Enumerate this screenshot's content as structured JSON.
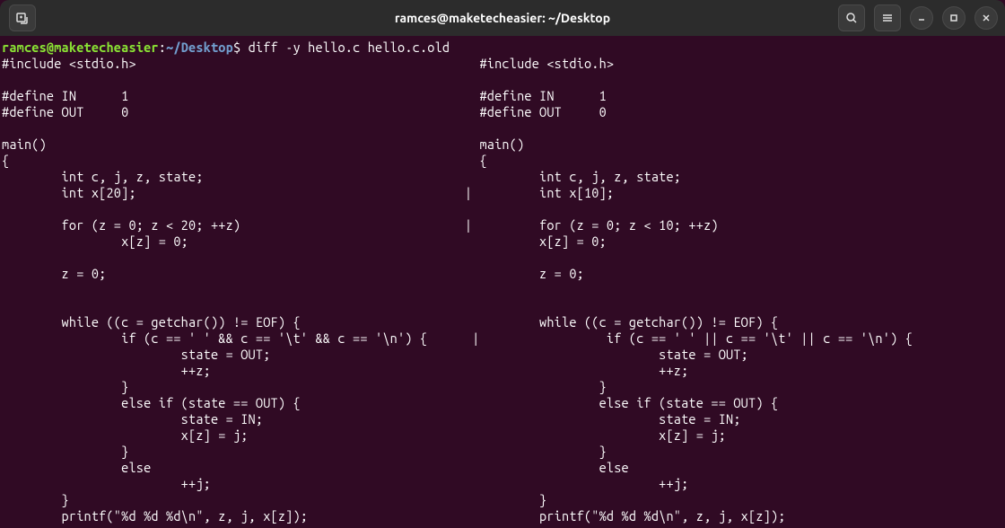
{
  "titlebar": {
    "title": "ramces@maketecheasier: ~/Desktop"
  },
  "prompt": {
    "user": "ramces@maketecheasier",
    "colon": ":",
    "path": "~/Desktop",
    "dollar": "$",
    "command": " diff -y hello.c hello.c.old"
  },
  "diff": {
    "lines": {
      "l0": "#include <stdio.h>                                              #include <stdio.h>",
      "l1": "",
      "l2": "#define IN      1                                               #define IN      1",
      "l3": "#define OUT     0                                               #define OUT     0",
      "l4": "",
      "l5": "main()                                                          main()",
      "l6": "{                                                               {",
      "l7": "        int c, j, z, state;                                             int c, j, z, state;",
      "l8": "        int x[20];                                            |         int x[10];",
      "l9": "",
      "l10": "        for (z = 0; z < 20; ++z)                              |         for (z = 0; z < 10; ++z)",
      "l11": "                x[z] = 0;                                               x[z] = 0;",
      "l12": "",
      "l13": "        z = 0;                                                          z = 0;",
      "l14": "",
      "l15": "",
      "l16": "        while ((c = getchar()) != EOF) {                                while ((c = getchar()) != EOF) {",
      "l17": "                if (c == ' ' && c == '\\t' && c == '\\n') {      |                 if (c == ' ' || c == '\\t' || c == '\\n') {",
      "l18": "                        state = OUT;                                                    state = OUT;",
      "l19": "                        ++z;                                                            ++z;",
      "l20": "                }                                                               }",
      "l21": "                else if (state == OUT) {                                        else if (state == OUT) {",
      "l22": "                        state = IN;                                                     state = IN;",
      "l23": "                        x[z] = j;                                                       x[z] = j;",
      "l24": "                }                                                               }",
      "l25": "                else                                                            else",
      "l26": "                        ++j;                                                            ++j;",
      "l27": "        }                                                               }",
      "l28": "        printf(\"%d %d %d\\n\", z, j, x[z]);                               printf(\"%d %d %d\\n\", z, j, x[z]);"
    }
  }
}
